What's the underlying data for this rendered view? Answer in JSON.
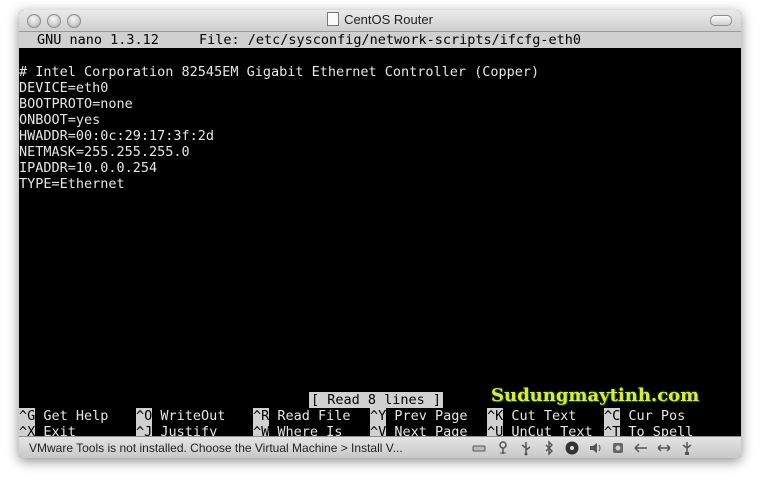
{
  "window": {
    "title": "CentOS Router"
  },
  "nano": {
    "version": "GNU nano 1.3.12",
    "file_label": "File: /etc/sysconfig/network-scripts/ifcfg-eth0",
    "lines": [
      "# Intel Corporation 82545EM Gigabit Ethernet Controller (Copper)",
      "DEVICE=eth0",
      "BOOTPROTO=none",
      "ONBOOT=yes",
      "HWADDR=00:0c:29:17:3f:2d",
      "NETMASK=255.255.255.0",
      "IPADDR=10.0.0.254",
      "TYPE=Ethernet"
    ],
    "status_message": "[ Read 8 lines ]",
    "shortcuts_row1": [
      {
        "key": "^G",
        "label": "Get Help"
      },
      {
        "key": "^O",
        "label": "WriteOut"
      },
      {
        "key": "^R",
        "label": "Read File"
      },
      {
        "key": "^Y",
        "label": "Prev Page"
      },
      {
        "key": "^K",
        "label": "Cut Text"
      },
      {
        "key": "^C",
        "label": "Cur Pos"
      }
    ],
    "shortcuts_row2": [
      {
        "key": "^X",
        "label": "Exit"
      },
      {
        "key": "^J",
        "label": "Justify"
      },
      {
        "key": "^W",
        "label": "Where Is"
      },
      {
        "key": "^V",
        "label": "Next Page"
      },
      {
        "key": "^U",
        "label": "UnCut Text"
      },
      {
        "key": "^T",
        "label": "To Spell"
      }
    ]
  },
  "watermark": "Sudungmaytinh.com",
  "vmware_status": {
    "message": "VMware Tools is not installed. Choose the Virtual Machine > Install V...",
    "icons": [
      "hard-disk-icon",
      "usb-icon",
      "bluetooth-icon",
      "cd-dvd-icon",
      "sound-icon",
      "camera-icon",
      "network-left-icon",
      "network-right-icon",
      "usb-device-icon",
      "printer-icon"
    ]
  },
  "colors": {
    "terminal_bg": "#000000",
    "terminal_fg": "#e6e6e6",
    "highlight_bg": "#d0d0d0",
    "watermark": "#d9e84a"
  }
}
